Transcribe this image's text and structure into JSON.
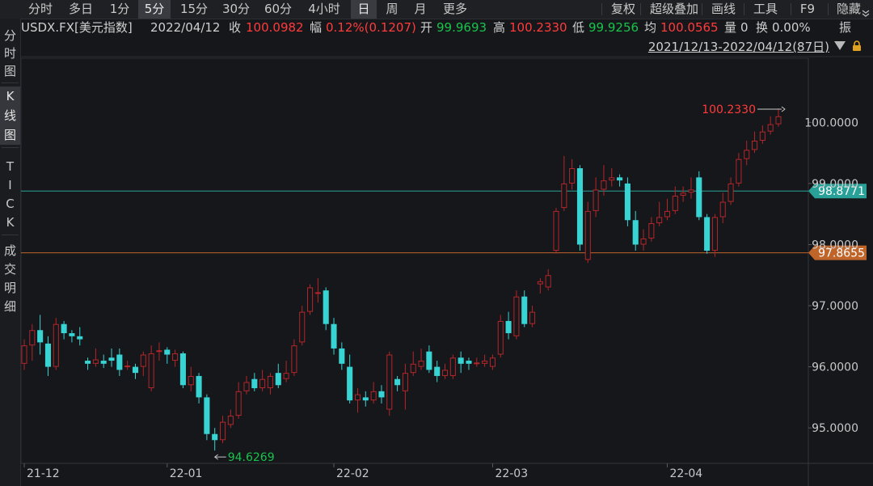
{
  "tabs": [
    "分时",
    "多日",
    "1分",
    "5分",
    "15分",
    "30分",
    "60分",
    "4小时",
    "日",
    "周",
    "月",
    "更多"
  ],
  "active_tabs": [
    "5分",
    "日"
  ],
  "tools": [
    "复权",
    "超级叠加",
    "画线",
    "工具",
    "F9",
    "隐藏"
  ],
  "tools_extra_icon": "chevron-down-icon",
  "sidebar": [
    {
      "label": "分时图",
      "active": false
    },
    {
      "label": "K线图",
      "active": true
    },
    {
      "label": "TICK",
      "active": false
    },
    {
      "label": "成交明细",
      "active": false
    }
  ],
  "info": {
    "symbol": "USDX.FX[美元指数]",
    "date": "2022/04/12",
    "close_label": "收",
    "close": "100.0982",
    "change_label": "幅",
    "change": "0.12%(0.1207)",
    "open_label": "开",
    "open": "99.9693",
    "high_label": "高",
    "high": "100.2330",
    "low_label": "低",
    "low": "99.9256",
    "avg_label": "均",
    "avg": "100.0565",
    "vol_label": "量",
    "vol": "0",
    "turnover_label": "换",
    "turnover": "0.00%",
    "amp_label": "振"
  },
  "range_text": "2021/12/13-2022/04/12(87日)",
  "colors": {
    "up": "#ff3b3b",
    "down_candle": "#38d3d3",
    "down_text": "#19c34b",
    "teal_line": "#2aa198",
    "orange_line": "#c0652a"
  },
  "chart_data": {
    "type": "candlestick",
    "x_tick_labels": [
      "21-12",
      "22-01",
      "22-02",
      "22-03",
      "22-04"
    ],
    "y_tick_labels": [
      "95.0000",
      "96.0000",
      "97.0000",
      "98.0000",
      "99.0000",
      "100.0000"
    ],
    "ylim": [
      94.42,
      101.05
    ],
    "high_annotation": "100.2330",
    "low_annotation": "94.6269",
    "hlines": [
      {
        "value": 98.8771,
        "label": "98.8771",
        "color": "#2aa198"
      },
      {
        "value": 97.8655,
        "label": "97.8655",
        "color": "#c0652a"
      }
    ],
    "candles": [
      [
        96.05,
        96.35,
        96.45,
        95.95
      ],
      [
        96.35,
        96.6,
        96.7,
        96.1
      ],
      [
        96.6,
        96.4,
        96.85,
        96.2
      ],
      [
        96.38,
        96.0,
        96.5,
        95.85
      ],
      [
        96.0,
        96.7,
        96.8,
        95.95
      ],
      [
        96.7,
        96.55,
        96.75,
        96.45
      ],
      [
        96.55,
        96.5,
        96.6,
        96.4
      ],
      [
        96.5,
        96.45,
        96.65,
        96.35
      ],
      [
        96.1,
        96.05,
        96.15,
        95.95
      ],
      [
        96.05,
        96.12,
        96.3,
        96.0
      ],
      [
        96.1,
        96.05,
        96.2,
        95.98
      ],
      [
        96.15,
        96.1,
        96.3,
        96.0
      ],
      [
        96.2,
        95.95,
        96.3,
        95.85
      ],
      [
        96.0,
        96.02,
        96.1,
        95.95
      ],
      [
        96.0,
        95.9,
        96.05,
        95.8
      ],
      [
        96.0,
        96.2,
        96.25,
        95.85
      ],
      [
        95.65,
        96.22,
        96.35,
        95.6
      ],
      [
        96.25,
        96.27,
        96.4,
        96.1
      ],
      [
        96.28,
        96.2,
        96.32,
        96.05
      ],
      [
        96.1,
        96.22,
        96.28,
        96.0
      ],
      [
        96.22,
        95.7,
        96.25,
        95.65
      ],
      [
        95.7,
        95.85,
        96.0,
        95.6
      ],
      [
        95.85,
        95.5,
        95.9,
        95.4
      ],
      [
        95.5,
        94.9,
        95.55,
        94.8
      ],
      [
        94.9,
        94.8,
        95.0,
        94.63
      ],
      [
        94.8,
        95.1,
        95.2,
        94.75
      ],
      [
        95.05,
        95.2,
        95.3,
        95.0
      ],
      [
        95.2,
        95.6,
        95.75,
        95.15
      ],
      [
        95.6,
        95.75,
        95.85,
        95.55
      ],
      [
        95.8,
        95.65,
        95.9,
        95.6
      ],
      [
        95.65,
        95.8,
        95.95,
        95.6
      ],
      [
        95.65,
        95.85,
        95.9,
        95.55
      ],
      [
        95.9,
        95.7,
        96.05,
        95.65
      ],
      [
        95.8,
        95.9,
        96.1,
        95.75
      ],
      [
        95.9,
        96.35,
        96.45,
        95.85
      ],
      [
        96.4,
        96.9,
        97.0,
        96.35
      ],
      [
        96.9,
        97.3,
        97.35,
        96.85
      ],
      [
        97.2,
        97.22,
        97.45,
        97.05
      ],
      [
        97.25,
        96.7,
        97.3,
        96.6
      ],
      [
        96.7,
        96.3,
        96.8,
        96.2
      ],
      [
        96.3,
        96.05,
        96.4,
        95.95
      ],
      [
        96.0,
        95.45,
        96.2,
        95.4
      ],
      [
        95.45,
        95.55,
        95.65,
        95.25
      ],
      [
        95.5,
        95.45,
        95.6,
        95.35
      ],
      [
        95.45,
        95.6,
        95.75,
        95.4
      ],
      [
        95.6,
        95.5,
        95.7,
        95.4
      ],
      [
        95.3,
        96.2,
        96.25,
        95.2
      ],
      [
        95.8,
        95.7,
        95.85,
        95.6
      ],
      [
        95.6,
        95.9,
        96.05,
        95.3
      ],
      [
        95.9,
        96.05,
        96.25,
        95.85
      ],
      [
        96.0,
        96.1,
        96.3,
        95.95
      ],
      [
        96.25,
        95.95,
        96.35,
        95.9
      ],
      [
        96.0,
        95.85,
        96.1,
        95.75
      ],
      [
        95.85,
        95.95,
        96.05,
        95.8
      ],
      [
        95.85,
        96.15,
        96.2,
        95.8
      ],
      [
        96.15,
        96.05,
        96.25,
        95.9
      ],
      [
        96.1,
        96.05,
        96.15,
        95.95
      ],
      [
        96.05,
        96.07,
        96.15,
        96.0
      ],
      [
        96.05,
        96.1,
        96.2,
        96.0
      ],
      [
        96.0,
        96.15,
        96.2,
        95.95
      ],
      [
        96.2,
        96.75,
        96.85,
        96.15
      ],
      [
        96.75,
        96.55,
        96.9,
        96.45
      ],
      [
        96.5,
        97.15,
        97.25,
        96.45
      ],
      [
        97.15,
        96.7,
        97.25,
        96.65
      ],
      [
        96.7,
        96.9,
        97.0,
        96.65
      ],
      [
        97.35,
        97.4,
        97.45,
        97.2
      ],
      [
        97.3,
        97.5,
        97.6,
        97.25
      ],
      [
        97.9,
        98.55,
        98.6,
        97.85
      ],
      [
        98.6,
        99.0,
        99.45,
        98.55
      ],
      [
        99.0,
        99.25,
        99.4,
        98.9
      ],
      [
        99.25,
        98.0,
        99.3,
        97.9
      ],
      [
        97.75,
        98.55,
        98.7,
        97.7
      ],
      [
        98.55,
        98.9,
        99.1,
        98.45
      ],
      [
        98.9,
        99.05,
        99.3,
        98.8
      ],
      [
        99.05,
        99.1,
        99.25,
        98.95
      ],
      [
        99.1,
        99.05,
        99.15,
        98.95
      ],
      [
        99.0,
        98.4,
        99.1,
        98.3
      ],
      [
        98.4,
        98.0,
        98.55,
        97.9
      ],
      [
        98.0,
        98.1,
        98.25,
        97.9
      ],
      [
        98.1,
        98.35,
        98.45,
        98.05
      ],
      [
        98.35,
        98.45,
        98.7,
        98.3
      ],
      [
        98.45,
        98.55,
        98.75,
        98.4
      ],
      [
        98.55,
        98.8,
        98.95,
        98.5
      ],
      [
        98.8,
        98.85,
        98.95,
        98.7
      ],
      [
        98.85,
        98.9,
        99.1,
        98.75
      ],
      [
        99.1,
        98.45,
        99.2,
        98.4
      ],
      [
        98.45,
        97.9,
        98.5,
        97.85
      ],
      [
        97.9,
        98.45,
        98.5,
        97.8
      ],
      [
        98.45,
        98.7,
        98.85,
        98.35
      ],
      [
        98.7,
        99.0,
        99.1,
        98.65
      ],
      [
        99.0,
        99.4,
        99.5,
        98.95
      ],
      [
        99.4,
        99.55,
        99.7,
        99.3
      ],
      [
        99.55,
        99.7,
        99.85,
        99.5
      ],
      [
        99.7,
        99.85,
        99.95,
        99.65
      ],
      [
        99.85,
        99.97,
        100.1,
        99.8
      ],
      [
        99.97,
        100.1,
        100.23,
        99.93
      ]
    ]
  }
}
